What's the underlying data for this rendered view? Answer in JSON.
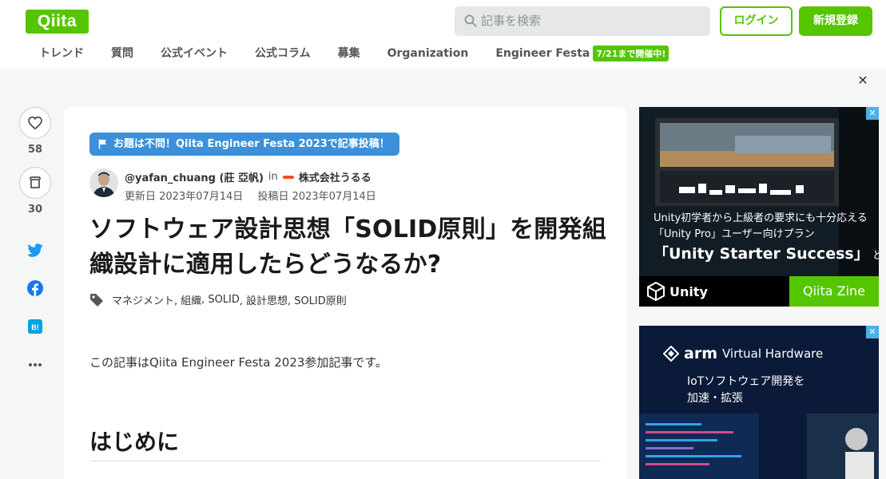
{
  "header": {
    "logo": "Qiita",
    "search_placeholder": "記事を検索",
    "login": "ログイン",
    "signup": "新規登録",
    "nav": [
      "トレンド",
      "質問",
      "公式イベント",
      "公式コラム",
      "募集",
      "Organization",
      "Engineer Festa"
    ],
    "nav_badge": "7/21まで開催中!"
  },
  "rail": {
    "likes": "58",
    "stocks": "30"
  },
  "article": {
    "festa_banner": "お題は不問！Qiita Engineer Festa 2023で記事投稿！",
    "author": "@yafan_chuang (莊 亞帆)",
    "in": "in",
    "org": "株式会社うるる",
    "updated": "更新日 2023年07月14日",
    "posted": "投稿日 2023年07月14日",
    "title": "ソフトウェア設計思想「SOLID原則」を開発組織設計に適用したらどうなるか?",
    "tags": [
      "マネジメント",
      "組織",
      "SOLID",
      "設計思想",
      "SOLID原則"
    ],
    "intro": "この記事はQiita Engineer Festa 2023参加記事です。",
    "heading": "はじめに"
  },
  "ad1": {
    "line1": "Unity初学者から上級者の要求にも十分応える",
    "line2": "「Unity Pro」ユーザー向けプラン",
    "line3": "「Unity Starter Success」",
    "line3b": "とは",
    "brand": "Unity",
    "zine": "Qiita Zine"
  },
  "ad2": {
    "brand": "arm",
    "product": "Virtual Hardware",
    "line1": "IoTソフトウェア開発を",
    "line2": "加速・拡張"
  },
  "colors": {
    "accent": "#55c500",
    "festa": "#3b90d9"
  }
}
